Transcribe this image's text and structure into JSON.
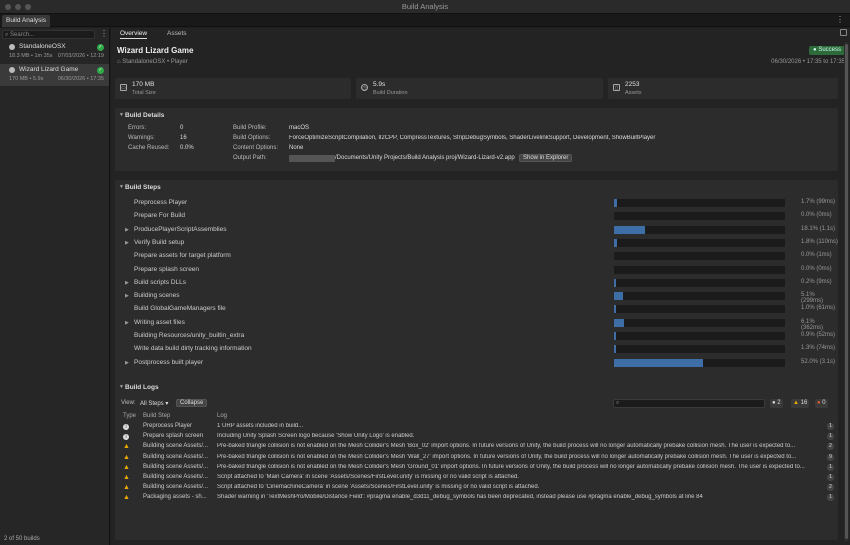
{
  "window": {
    "title": "Build Analysis",
    "tab": "Build Analysis"
  },
  "sidebar": {
    "search_placeholder": "Search...",
    "builds": [
      {
        "name": "StandaloneOSX",
        "meta": "18.3 MB • 1m 35s",
        "date": "07/03/2026 • 12:19",
        "status": "success"
      },
      {
        "name": "Wizard Lizard Game",
        "meta": "170 MB • 5.9s",
        "date": "06/30/2026 • 17:35",
        "status": "success"
      }
    ],
    "footer": "2 of 50 builds"
  },
  "tabs": [
    "Overview",
    "Assets"
  ],
  "header": {
    "title": "Wizard Lizard Game",
    "subtitle": "StandaloneOSX • Player",
    "status": "Success",
    "time_range": "06/30/2026 • 17:35 to 17:35"
  },
  "stats": [
    {
      "value": "170 MB",
      "label": "Total Size",
      "icon": "disk-icon"
    },
    {
      "value": "5.9s",
      "label": "Build Duration",
      "icon": "clock-icon"
    },
    {
      "value": "2253",
      "label": "Assets",
      "icon": "file-icon"
    }
  ],
  "details": {
    "title": "Build Details",
    "left": [
      {
        "label": "Errors:",
        "value": "0"
      },
      {
        "label": "Warnings:",
        "value": "16"
      },
      {
        "label": "Cache Reused:",
        "value": "0.0%"
      }
    ],
    "right": [
      {
        "label": "Build Profile:",
        "value": "macOS"
      },
      {
        "label": "Build Options:",
        "value": "ForceOptimizeScriptCompilation, Il2CPP, CompressTextures, StripDebugSymbols, ShaderLivelinkSupport, Development, ShowBuiltPlayer"
      },
      {
        "label": "Content Options:",
        "value": "None"
      },
      {
        "label": "Output Path:",
        "value": "/Documents/Unity Projects/Build Analysis proj/Wizard-Lizard-v2.app"
      }
    ],
    "show_button": "Show in Explorer"
  },
  "steps": {
    "title": "Build Steps",
    "items": [
      {
        "name": "Preprocess Player",
        "pct": "1.7% (99ms)",
        "frac": 0.017,
        "expand": false
      },
      {
        "name": "Prepare For Build",
        "pct": "0.0% (0ms)",
        "frac": 0.0,
        "expand": false
      },
      {
        "name": "ProducePlayerScriptAssemblies",
        "pct": "18.1% (1.1s)",
        "frac": 0.181,
        "expand": true
      },
      {
        "name": "Verify Build setup",
        "pct": "1.8% (110ms)",
        "frac": 0.018,
        "expand": true
      },
      {
        "name": "Prepare assets for target platform",
        "pct": "0.0% (1ms)",
        "frac": 0.0,
        "expand": false
      },
      {
        "name": "Prepare splash screen",
        "pct": "0.0% (0ms)",
        "frac": 0.0,
        "expand": false
      },
      {
        "name": "Build scripts DLLs",
        "pct": "0.2% (9ms)",
        "frac": 0.002,
        "expand": true
      },
      {
        "name": "Building scenes",
        "pct": "5.1% (299ms)",
        "frac": 0.051,
        "expand": true
      },
      {
        "name": "Build GlobalGameManagers file",
        "pct": "1.0% (61ms)",
        "frac": 0.01,
        "expand": false
      },
      {
        "name": "Writing asset files",
        "pct": "6.1% (362ms)",
        "frac": 0.061,
        "expand": true
      },
      {
        "name": "Building Resources/unity_builtin_extra",
        "pct": "0.9% (52ms)",
        "frac": 0.009,
        "expand": false
      },
      {
        "name": "Write data build dirty tracking information",
        "pct": "1.3% (74ms)",
        "frac": 0.013,
        "expand": false
      },
      {
        "name": "Postprocess built player",
        "pct": "52.0% (3.1s)",
        "frac": 0.52,
        "expand": true
      }
    ]
  },
  "logs": {
    "title": "Build Logs",
    "view_label": "View:",
    "view_value": "All Steps",
    "collapse": "Collapse",
    "counts": {
      "info": "2",
      "warn": "16",
      "error": "0"
    },
    "columns": [
      "Type",
      "Build Step",
      "Log"
    ],
    "rows": [
      {
        "type": "info",
        "step": "Preprocess Player",
        "msg": "1 URP assets included in build...",
        "count": "1"
      },
      {
        "type": "info",
        "step": "Prepare splash screen",
        "msg": "Including Unity Splash Screen logo because 'Show Unity Logo' is enabled.",
        "count": "1"
      },
      {
        "type": "warn",
        "step": "Building scene Assets/...",
        "msg": "Pre-baked triangle collision is not enabled on the Mesh Collider's Mesh 'Box_02' import options. In future versions of Unity, the build process will no longer automatically prebake collision mesh. The user is expected to...",
        "count": "2"
      },
      {
        "type": "warn",
        "step": "Building scene Assets/...",
        "msg": "Pre-baked triangle collision is not enabled on the Mesh Collider's Mesh 'Wall_27' import options. In future versions of Unity, the build process will no longer automatically prebake collision mesh. The user is expected to...",
        "count": "9"
      },
      {
        "type": "warn",
        "step": "Building scene Assets/...",
        "msg": "Pre-baked triangle collision is not enabled on the Mesh Collider's Mesh 'Ground_01' import options. In future versions of Unity, the build process will no longer automatically prebake collision mesh. The user is expected to...",
        "count": "1"
      },
      {
        "type": "warn",
        "step": "Building scene Assets/...",
        "msg": "Script attached to 'Main Camera' in scene 'Assets/Scenes/FirstLevel.unity' is missing or no valid script is attached.",
        "count": "1"
      },
      {
        "type": "warn",
        "step": "Building scene Assets/...",
        "msg": "Script attached to 'CinemachineCamera' in scene 'Assets/Scenes/FirstLevel.unity' is missing or no valid script is attached.",
        "count": "2"
      },
      {
        "type": "warn",
        "step": "Packaging assets - sh...",
        "msg": "Shader warning in 'TextMeshPro/Mobile/Distance Field': #pragma enable_d3d11_debug_symbols has been deprecated, instead please use #pragma enable_debug_symbols at line 84",
        "count": "1"
      }
    ]
  }
}
